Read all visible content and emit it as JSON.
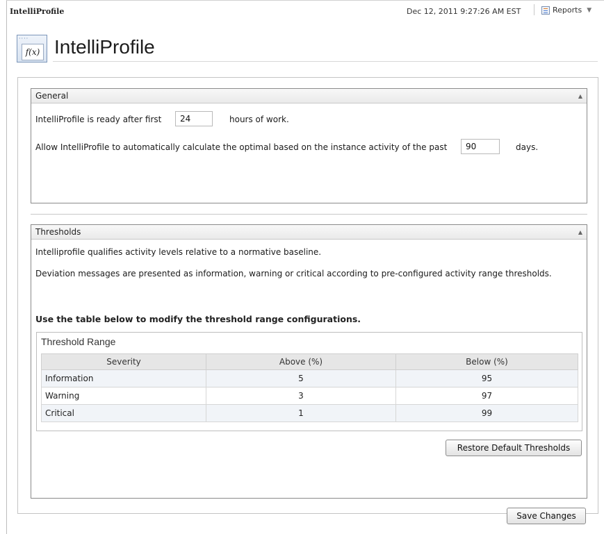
{
  "header": {
    "app_name": "IntelliProfile",
    "timestamp": "Dec 12, 2011 9:27:26 AM EST",
    "reports_label": "Reports",
    "reports_icon": "report-icon",
    "caret_icon": "chevron-down-icon"
  },
  "title": {
    "text": "IntelliProfile",
    "icon_label": "f(x)"
  },
  "general": {
    "title": "General",
    "ready_prefix": "IntelliProfile is ready after first",
    "ready_hours": "24",
    "ready_suffix": "hours of work.",
    "auto_prefix": "Allow IntelliProfile to automatically calculate the optimal based on the instance activity of the past",
    "auto_days": "90",
    "auto_suffix": "days."
  },
  "thresholds": {
    "title": "Thresholds",
    "line1": "Intelliprofile qualifies activity levels relative to a normative baseline.",
    "line2": "Deviation messages are presented as information, warning or critical according to pre-configured activity range thresholds.",
    "instruction": "Use the table below to modify the threshold range configurations.",
    "range_title": "Threshold Range",
    "columns": [
      "Severity",
      "Above (%)",
      "Below (%)"
    ],
    "rows": [
      {
        "severity": "Information",
        "above": "5",
        "below": "95",
        "color": "#2e9b2e"
      },
      {
        "severity": "Warning",
        "above": "3",
        "below": "97",
        "color": "#d9a400"
      },
      {
        "severity": "Critical",
        "above": "1",
        "below": "99",
        "color": "#e05a12"
      }
    ],
    "restore_label": "Restore Default Thresholds"
  },
  "footer": {
    "save_label": "Save Changes"
  }
}
